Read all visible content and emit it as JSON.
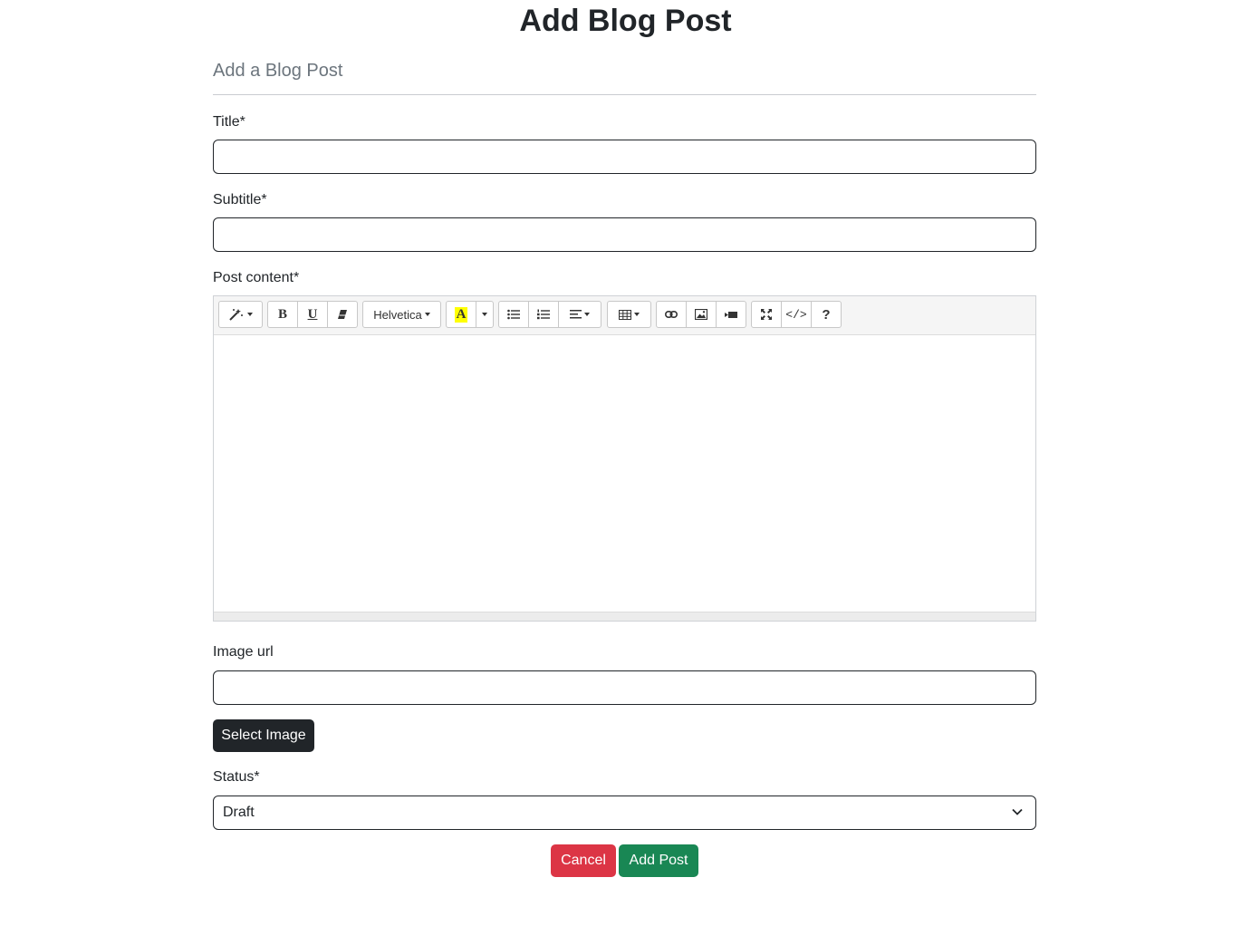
{
  "page": {
    "title": "Add Blog Post",
    "subheading": "Add a Blog Post"
  },
  "form": {
    "title_label": "Title*",
    "title_value": "",
    "subtitle_label": "Subtitle*",
    "subtitle_value": "",
    "content_label": "Post content*",
    "image_url_label": "Image url",
    "image_url_value": "",
    "select_image_button": "Select Image",
    "status_label": "Status*",
    "status_value": "Draft",
    "cancel_button": "Cancel",
    "submit_button": "Add Post"
  },
  "editor": {
    "font_name": "Helvetica",
    "color_letter": "A",
    "bold_letter": "B",
    "underline_letter": "U",
    "help_glyph": "?",
    "codeview_glyph": "</>",
    "toolbar_icons": [
      "magic-icon",
      "bold-icon",
      "underline-icon",
      "eraser-icon",
      "font-dropdown",
      "text-color-icon",
      "color-dropdown-caret",
      "unordered-list-icon",
      "ordered-list-icon",
      "paragraph-align-icon",
      "table-icon",
      "link-icon",
      "picture-icon",
      "video-icon",
      "fullscreen-icon",
      "codeview-icon",
      "help-icon"
    ]
  },
  "colors": {
    "cancel": "#dc3545",
    "submit": "#198754",
    "select_image": "#212529",
    "highlight": "#ffff00"
  }
}
